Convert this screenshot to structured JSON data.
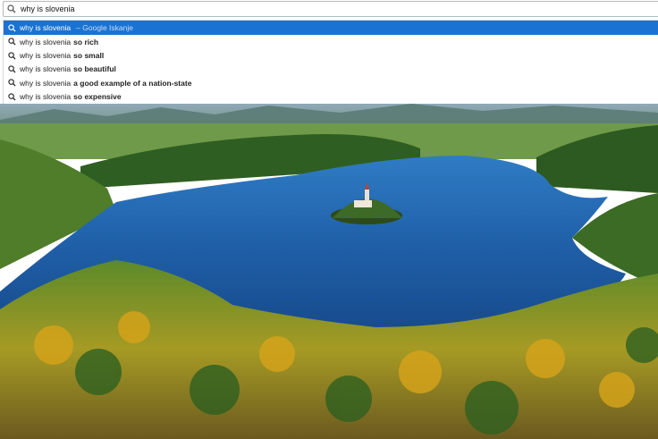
{
  "search": {
    "value": "why is slovenia",
    "icon": "search-icon"
  },
  "suggestions": [
    {
      "base": "why is slovenia",
      "completion": "",
      "meta": "– Google Iskanje",
      "selected": true
    },
    {
      "base": "why is slovenia",
      "completion": "so rich",
      "meta": "",
      "selected": false
    },
    {
      "base": "why is slovenia",
      "completion": "so small",
      "meta": "",
      "selected": false
    },
    {
      "base": "why is slovenia",
      "completion": "so beautiful",
      "meta": "",
      "selected": false
    },
    {
      "base": "why is slovenia",
      "completion": "a good example of a nation-state",
      "meta": "",
      "selected": false
    },
    {
      "base": "why is slovenia",
      "completion": "so expensive",
      "meta": "",
      "selected": false
    }
  ],
  "colors": {
    "selected_bg": "#1a73d2",
    "lake": "#1f5fa8",
    "forest": "#3f7a2a",
    "autumn": "#c9a21c"
  }
}
